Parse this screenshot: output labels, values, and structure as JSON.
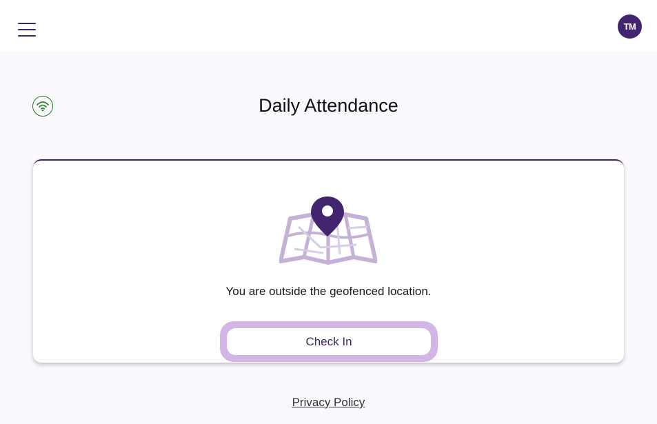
{
  "header": {
    "avatar_initials": "TM"
  },
  "page": {
    "title": "Daily Attendance"
  },
  "card": {
    "message": "You are outside the geofenced location.",
    "checkin_label": "Check In"
  },
  "footer": {
    "privacy_label": "Privacy Policy"
  },
  "colors": {
    "brand": "#43246e",
    "button_outline": "#d4b6e6",
    "status_ok": "#1f7a1f",
    "map_muted": "#c4b2d6"
  },
  "icons": {
    "menu": "hamburger-menu-icon",
    "connection": "wifi-icon",
    "location": "location-pin-icon",
    "map": "folded-map-icon"
  }
}
